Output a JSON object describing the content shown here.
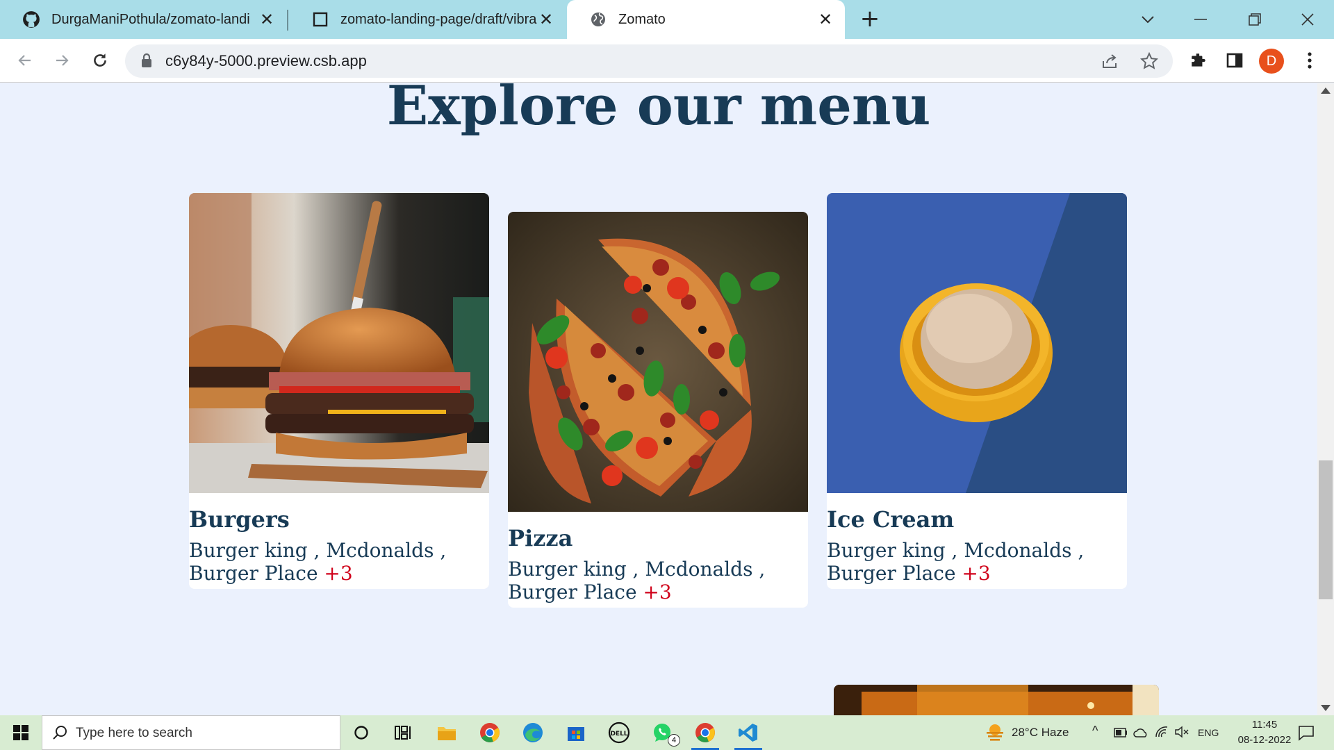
{
  "browser": {
    "tabs": [
      {
        "title": "DurgaManiPothula/zomato-landi",
        "icon": "github-icon",
        "active": false
      },
      {
        "title": "zomato-landing-page/draft/vibra",
        "icon": "codesandbox-icon",
        "active": false
      },
      {
        "title": "Zomato",
        "icon": "globe-icon",
        "active": true
      }
    ],
    "url": "c6y84y-5000.preview.csb.app",
    "profile_initial": "D"
  },
  "page": {
    "section_title": "Explore our menu",
    "cards": [
      {
        "title": "Burgers",
        "desc": "Burger king , Mcdonalds , Burger Place",
        "more": "+3",
        "image": "burger-photo"
      },
      {
        "title": "Pizza",
        "desc": "Burger king , Mcdonalds , Burger Place",
        "more": "+3",
        "image": "pizza-photo"
      },
      {
        "title": "Ice Cream",
        "desc": "Burger king , Mcdonalds , Burger Place",
        "more": "+3",
        "image": "ice-cream-photo"
      }
    ],
    "colors": {
      "background": "#ebf1fd",
      "heading": "#183b56",
      "accent": "#d0021b"
    }
  },
  "taskbar": {
    "search_placeholder": "Type here to search",
    "weather": "28°C  Haze",
    "language": "ENG",
    "time": "11:45",
    "date": "08-12-2022",
    "whatsapp_badge": "4"
  }
}
